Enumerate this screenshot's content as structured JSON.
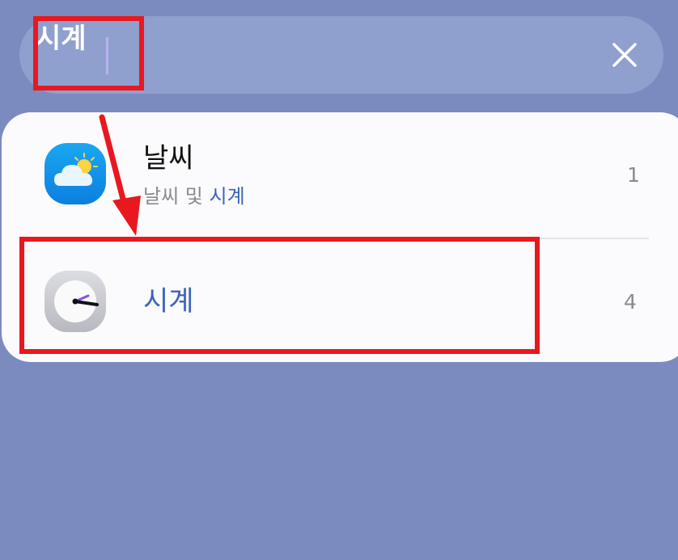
{
  "search": {
    "query": "시계",
    "clear_icon": "close-icon"
  },
  "results": [
    {
      "title": "날씨",
      "subtitle_prefix": "날씨 및 ",
      "subtitle_highlight": "시계",
      "count": "1",
      "icon": "weather-app-icon"
    },
    {
      "title": "시계",
      "count": "4",
      "icon": "clock-app-icon"
    }
  ],
  "colors": {
    "background": "#7b8bc0",
    "search_bar": "#8fa0cf",
    "highlight_text": "#3b64b8",
    "annotation": "#e8181e"
  }
}
